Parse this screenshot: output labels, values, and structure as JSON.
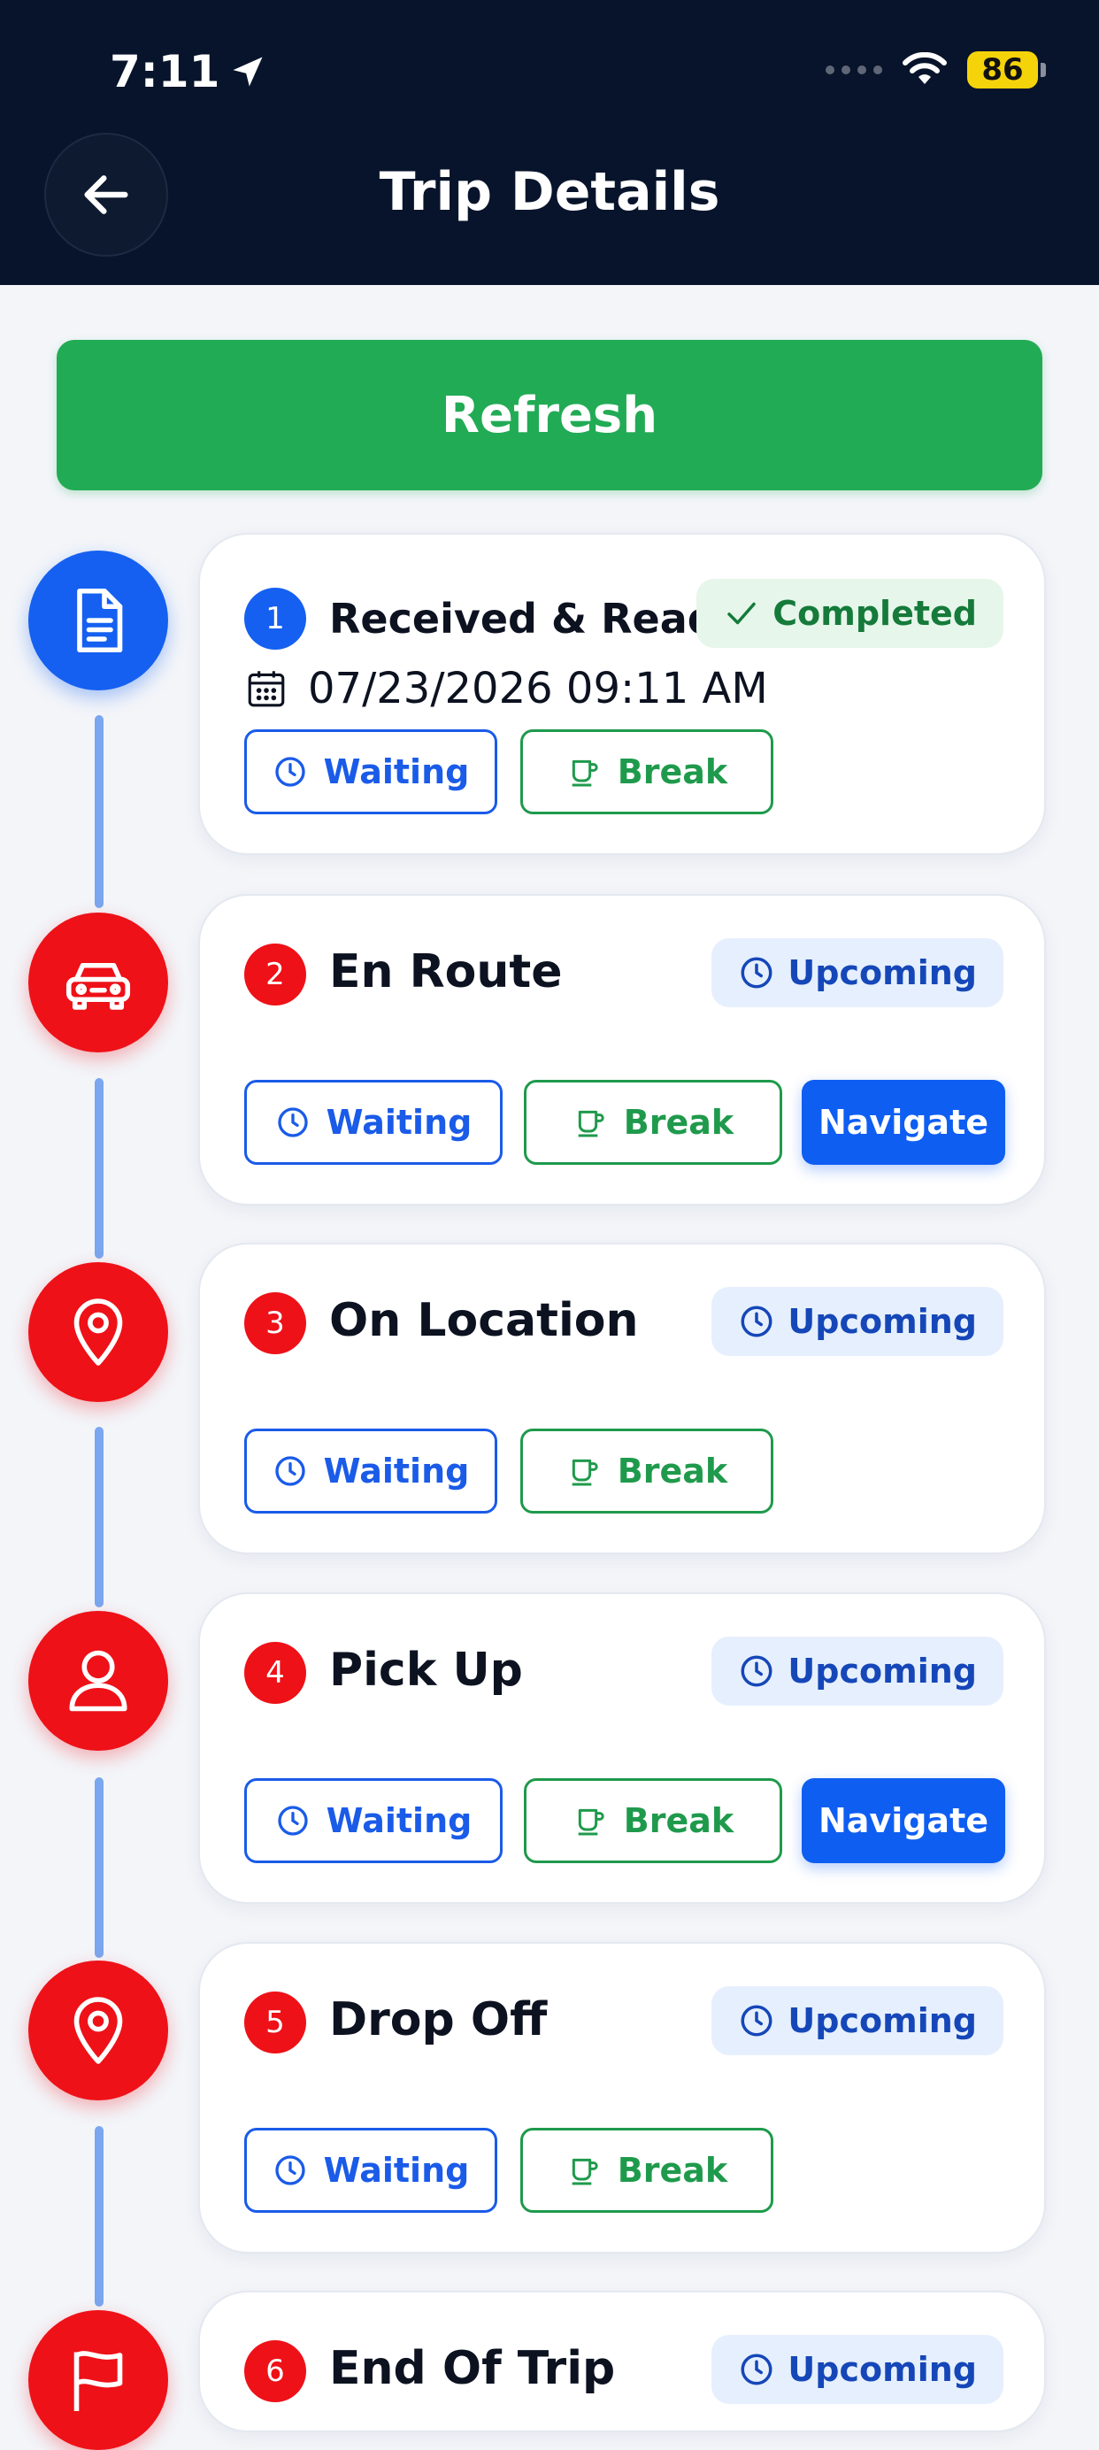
{
  "status_bar": {
    "time": "7:11",
    "battery": "86"
  },
  "header": {
    "title": "Trip Details"
  },
  "refresh_label": "Refresh",
  "colors": {
    "header_bg": "#07142b",
    "refresh_green": "#22ab55",
    "primary_blue": "#1560f0",
    "alert_red": "#ee1118"
  },
  "steps": [
    {
      "number": "1",
      "title": "Received & Read",
      "status": "Completed",
      "date": "07/23/2026 09:11 AM",
      "icon": "document-icon",
      "waiting_label": "Waiting",
      "break_label": "Break"
    },
    {
      "number": "2",
      "title": "En Route",
      "status": "Upcoming",
      "icon": "car-icon",
      "waiting_label": "Waiting",
      "break_label": "Break",
      "navigate_label": "Navigate"
    },
    {
      "number": "3",
      "title": "On Location",
      "status": "Upcoming",
      "icon": "location-pin-icon",
      "waiting_label": "Waiting",
      "break_label": "Break"
    },
    {
      "number": "4",
      "title": "Pick Up",
      "status": "Upcoming",
      "icon": "person-icon",
      "waiting_label": "Waiting",
      "break_label": "Break",
      "navigate_label": "Navigate"
    },
    {
      "number": "5",
      "title": "Drop Off",
      "status": "Upcoming",
      "icon": "location-pin-icon",
      "waiting_label": "Waiting",
      "break_label": "Break"
    },
    {
      "number": "6",
      "title": "End Of Trip",
      "status": "Upcoming",
      "icon": "flag-icon"
    }
  ]
}
